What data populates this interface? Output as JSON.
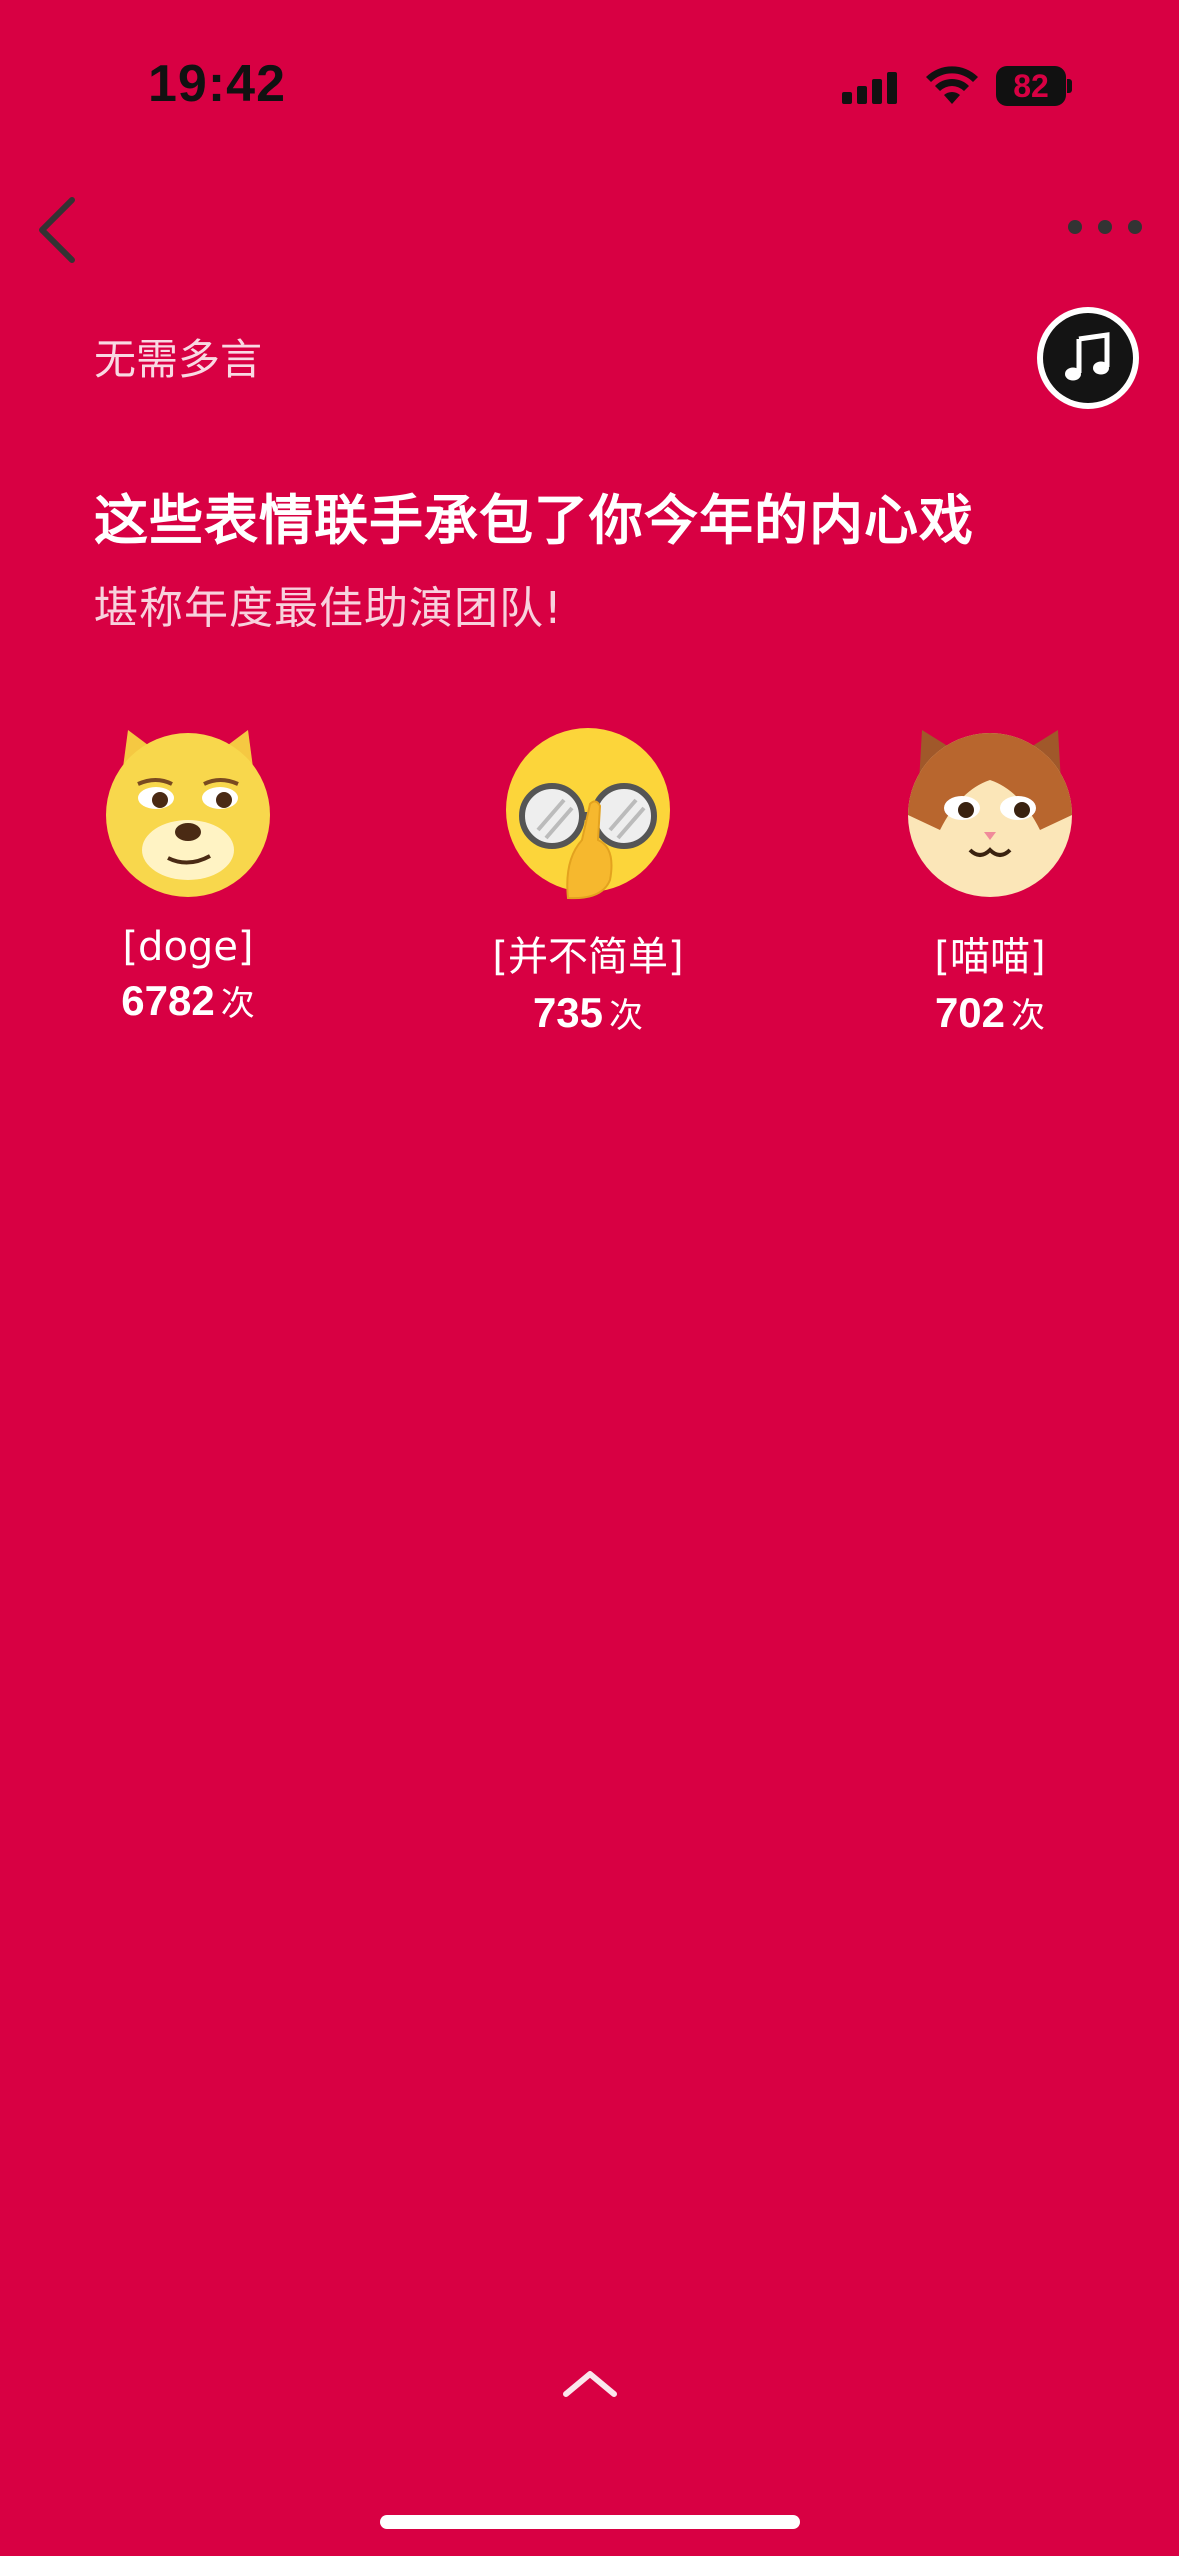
{
  "status_bar": {
    "time": "19:42",
    "battery": "82",
    "signal_icon": "cellular-signal-icon",
    "wifi_icon": "wifi-icon",
    "battery_icon": "battery-icon"
  },
  "nav": {
    "back_icon": "chevron-left-icon",
    "more_icon": "ellipsis-icon",
    "music_icon": "music-note-icon"
  },
  "content": {
    "tagline": "无需多言",
    "headline": "这些表情联手承包了你今年的内心戏",
    "subline": "堪称年度最佳助演团队!"
  },
  "emojis": [
    {
      "name": "[doge]",
      "count": "6782",
      "unit": "次",
      "icon": "doge-dog-emoji"
    },
    {
      "name": "[并不简单]",
      "count": "735",
      "unit": "次",
      "icon": "glasses-thinking-emoji"
    },
    {
      "name": "[喵喵]",
      "count": "702",
      "unit": "次",
      "icon": "cat-emoji"
    }
  ],
  "footer": {
    "swipe_up_icon": "chevron-up-icon"
  },
  "colors": {
    "background": "#D80043",
    "text": "#FFFFFF"
  }
}
